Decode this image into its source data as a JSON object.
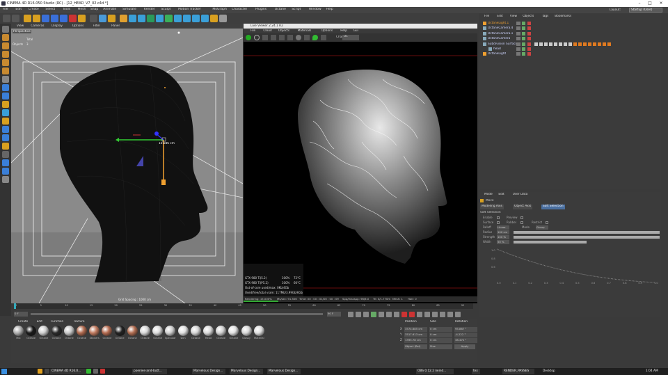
{
  "window": {
    "title": "CINEMA 4D R16.050 Studio (RC) - [12_HEAD_V7_02.c4d *]"
  },
  "menu": [
    "File",
    "Edit",
    "Create",
    "Select",
    "Tools",
    "Mesh",
    "Snap",
    "Animate",
    "Simulate",
    "Render",
    "Sculpt",
    "Motion Tracker",
    "MoGraph",
    "Character",
    "Plugins",
    "Octane",
    "Script",
    "Window",
    "Help"
  ],
  "layout": {
    "label": "Layout:",
    "value": "Startup (User)"
  },
  "viewport": {
    "menu": [
      "View",
      "Cameras",
      "Display",
      "Options",
      "Filter",
      "Panel"
    ],
    "camera_label": "Perspective",
    "gizmo_readout": "10.886 cm",
    "grid_spacing": "Grid Spacing : 1000 cm",
    "hud_label_1": "Total",
    "hud_label_2": "Objects",
    "hud_value_2": "3"
  },
  "live_viewer": {
    "title": "Live Viewer 2.24.1 R2",
    "menu": [
      "File",
      "Cloud",
      "Objects",
      "Materials",
      "Options",
      "Help",
      "Gui"
    ],
    "channel_label": "Chan:",
    "channel_value": "DL",
    "stats": [
      {
        "device": "GTX 980 Ti(5.2)",
        "a": "100%",
        "b": "72°C"
      },
      {
        "device": "GTX 980 Ti(P5.2)",
        "a": "100%",
        "b": "60°C"
      }
    ],
    "mem_line_1": "Out-of-core used/max: 0Kb/4Gb",
    "mem_line_2": "Used/free/total vram: 117Mb/3.99Gb/6Gb",
    "status": {
      "rendering": "Rendering: 15.000%",
      "ms": "Ms/sec: 91.506",
      "time": "Time: 00 : 00 : 01/00 : 00 : 09",
      "spp": "Spp/maxspp: 96/6.0",
      "tri": "Tri: 0/1.770m",
      "mesh": "Mesh: 1",
      "hair": "Hair: 0"
    }
  },
  "objects": {
    "menu": [
      "File",
      "Edit",
      "View",
      "Objects",
      "Tags",
      "Bookmarks"
    ],
    "items": [
      {
        "name": "OctaneLight.1",
        "indent": 0
      },
      {
        "name": "OctaneCamera.4",
        "indent": 0
      },
      {
        "name": "OctaneCamera.1",
        "indent": 0
      },
      {
        "name": "OctaneCamera",
        "indent": 0
      },
      {
        "name": "Subdivision Surface",
        "indent": 0
      },
      {
        "name": "head",
        "indent": 1
      },
      {
        "name": "OctaneLight",
        "indent": 0
      }
    ]
  },
  "attributes": {
    "menu": [
      "Mode",
      "Edit",
      "User Data"
    ],
    "mode_title": "Move",
    "tabs": [
      "Modeling Axis",
      "Object Axis",
      "Soft Selection"
    ],
    "section": "Soft Selection",
    "fields": [
      {
        "label": "Enable",
        "value": ""
      },
      {
        "label": "Preview",
        "value": ""
      },
      {
        "label": "Surface",
        "value": ""
      },
      {
        "label": "Rubber",
        "value": ""
      },
      {
        "label": "Restrict",
        "value": ""
      },
      {
        "label": "Falloff",
        "value": "Linear"
      },
      {
        "label": "Mode",
        "value": "Group"
      },
      {
        "label": "Radius",
        "value": "100 cm"
      },
      {
        "label": "Strength",
        "value": "100 %"
      },
      {
        "label": "Width",
        "value": "50 %"
      }
    ],
    "graph_y": [
      "1.0",
      "0.8",
      "0.6"
    ],
    "graph_x": [
      "0.0",
      "0.1",
      "0.2",
      "0.3",
      "0.4",
      "0.5",
      "0.6",
      "0.7",
      "0.8",
      "0.9",
      "1.0"
    ]
  },
  "timeline": {
    "ticks": [
      "0",
      "5",
      "10",
      "15",
      "20",
      "25",
      "30",
      "35",
      "40",
      "45",
      "50",
      "55",
      "60",
      "65",
      "70",
      "75",
      "80",
      "85",
      "90"
    ],
    "start": "0 F",
    "end": "90 F",
    "current": "0 F"
  },
  "materials": {
    "menu": [
      "Create",
      "Edit",
      "Function",
      "Texture"
    ],
    "names": [
      "Mix",
      "Octane",
      "Octane",
      "Octane",
      "Octane",
      "Octane",
      "Stickers",
      "Octane",
      "Octane",
      "Octane",
      "Octane",
      "Octane",
      "Specular",
      "skin",
      "Octane",
      "Head",
      "Octane",
      "Octane",
      "Glossy",
      "Material"
    ],
    "colors": [
      "#b0b0b0",
      "#1a1a1a",
      "#d0d0d0",
      "#2a2a2a",
      "#c8c8c8",
      "#b06a4f",
      "#c07a5f",
      "#b46b50",
      "#222222",
      "#b26e52",
      "#d8d8d8",
      "#dcdcdc",
      "#cfcfcf",
      "#e0e0e0",
      "#d5d5d5",
      "#dadada",
      "#d2d2d2",
      "#e2e2e2",
      "#d9d9d9",
      "#dedede"
    ]
  },
  "coordinates": {
    "headers": [
      "Position",
      "Size",
      "Rotation"
    ],
    "rows": [
      {
        "axis": "X",
        "pos": "3574.685 cm",
        "size": "0 cm",
        "rot": "95.867 °"
      },
      {
        "axis": "Y",
        "pos": "3517.613 cm",
        "size": "0 cm",
        "rot": "-4.222 °"
      },
      {
        "axis": "Z",
        "pos": "1395.78 cm",
        "size": "0 cm",
        "rot": "38.472 °"
      }
    ],
    "mode_1": "Object (Rel)",
    "mode_2": "Size",
    "apply": "Apply"
  },
  "taskbar": {
    "items": [
      "CINEMA 4D R16.0...",
      "poenies-and-butt...",
      "Marvelous Design...",
      "Marvelous Design...",
      "Marvelous Design...",
      "OBS 0.12.2 (wind...",
      "tex",
      "RENDER_PASSES"
    ],
    "desktop": "Desktop",
    "time": "1:04 AM"
  },
  "accent": "#f0a030"
}
